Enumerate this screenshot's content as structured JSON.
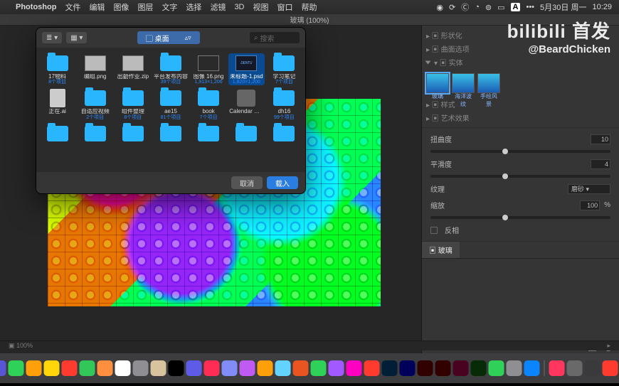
{
  "menubar": {
    "apple": "",
    "app": "Photoshop",
    "items": [
      "文件",
      "编辑",
      "图像",
      "图层",
      "文字",
      "选择",
      "滤镜",
      "3D",
      "视图",
      "窗口",
      "帮助"
    ],
    "right_icons": [
      "record",
      "sync",
      "circle",
      "wifi",
      "battery",
      "lang"
    ],
    "lang": "A",
    "date": "5月30日 周一",
    "time": "10:29"
  },
  "doc": {
    "title": "玻璃 (100%)"
  },
  "watermark": {
    "brand": "bilibili 首发",
    "user": "@BeardChicken"
  },
  "dialog": {
    "view1": "≣ ▾",
    "view2": "▦ ▾",
    "location": "▢ 桌面",
    "loc_arrow": "▵▿",
    "search_placeholder": "搜索",
    "cancel": "取消",
    "open": "载入",
    "items": [
      {
        "name": "17物料",
        "meta": "8个项目",
        "type": "folder"
      },
      {
        "name": "编组.png",
        "meta": "",
        "type": "img"
      },
      {
        "name": "出勤作业.zip",
        "meta": "",
        "type": "img"
      },
      {
        "name": "平台发布内容",
        "meta": "39个项目",
        "type": "folder"
      },
      {
        "name": "图像 16.png",
        "meta": "1,913×1,206",
        "type": "img-dark"
      },
      {
        "name": "未标题-1.psd",
        "meta": "1,820×1,200",
        "type": "psd",
        "selected": true
      },
      {
        "name": "学习笔记",
        "meta": "7个项目",
        "type": "folder"
      },
      {
        "name": "正在.ai",
        "meta": "",
        "type": "ai"
      },
      {
        "name": "自适应视频",
        "meta": "2个项目",
        "type": "folder"
      },
      {
        "name": "组件整理",
        "meta": "8个项目",
        "type": "folder"
      },
      {
        "name": "ae15",
        "meta": "81个项目",
        "type": "folder"
      },
      {
        "name": "book",
        "meta": "7个项目",
        "type": "folder"
      },
      {
        "name": "Calendar Card.sketch",
        "meta": "",
        "type": "cal"
      },
      {
        "name": "dh16",
        "meta": "99个项目",
        "type": "folder"
      },
      {
        "name": "",
        "meta": "",
        "type": "folder"
      },
      {
        "name": "",
        "meta": "",
        "type": "folder"
      },
      {
        "name": "",
        "meta": "",
        "type": "folder"
      },
      {
        "name": "",
        "meta": "",
        "type": "folder"
      },
      {
        "name": "",
        "meta": "",
        "type": "folder"
      },
      {
        "name": "",
        "meta": "",
        "type": "folder"
      },
      {
        "name": "",
        "meta": "",
        "type": "folder"
      }
    ]
  },
  "panels": {
    "row1": "▸ ▣ 形状化",
    "row2": "▸ ▣ 曲面选项",
    "row3_open": "▾ ▣ 实体",
    "thumbs": [
      {
        "label": "玻璃",
        "selected": true
      },
      {
        "label": "海洋波纹"
      },
      {
        "label": "手绘风景"
      }
    ],
    "row4": "▸ ▣ 样式",
    "row5": "▸ ▣ 艺术效果",
    "s1_label": "扭曲度",
    "s1_val": "10",
    "s2_label": "平滑度",
    "s2_val": "4",
    "sel_label": "纹理",
    "sel_val": "磨砂   ▾",
    "s3_label": "缩放",
    "s3_val": "100",
    "s3_unit": "%",
    "cb_label": "反相",
    "tab_active": "▣ 玻璃"
  },
  "status": {
    "left": "▣ 100%",
    "right": "▸"
  },
  "dock_colors": [
    "#2c6fe0",
    "#7dd0ff",
    "#47b4ff",
    "#d946a8",
    "#5856d6",
    "#30d158",
    "#ff9f0a",
    "#ffd60a",
    "#ff3b30",
    "#33c759",
    "#fd8f3f",
    "#fff",
    "#8e8e93",
    "#d7c49e",
    "#000",
    "#5e5ce6",
    "#ff2d55",
    "#818cf8",
    "#bf5af2",
    "#ff9f0a",
    "#64d2ff",
    "#e95420",
    "#30d158",
    "#a259ff",
    "#ff00c3",
    "#ff3b30",
    "#001e36",
    "#00005b",
    "#310000",
    "#330000",
    "#49021f",
    "#072b07",
    "#30d158",
    "#8e8e93",
    "#0a84ff",
    "#ff375f",
    "#696969",
    "#3a3a3c",
    "#ff3b30",
    "#8e8e93",
    "#8e8e93",
    "#8e8e93",
    "#8e8e93",
    "#48484a"
  ]
}
